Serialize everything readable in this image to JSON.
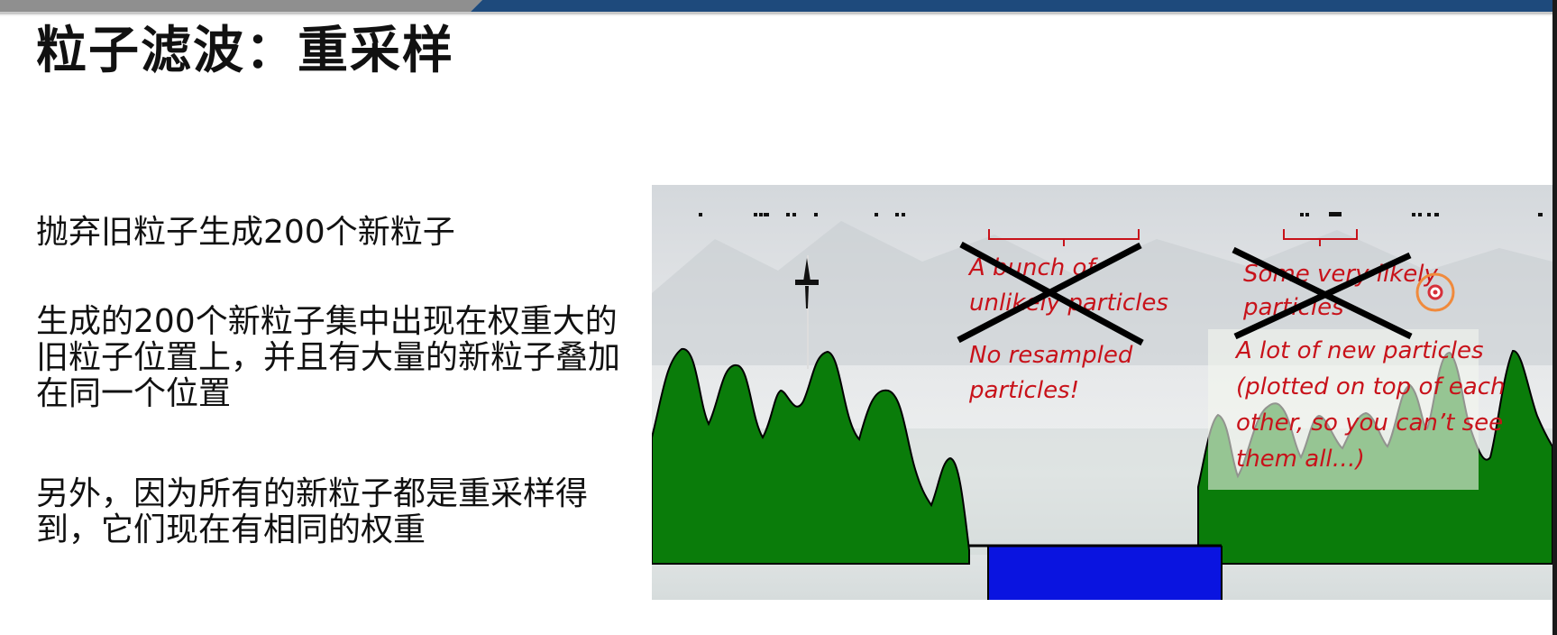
{
  "slide": {
    "title": "粒子滤波：重采样",
    "paragraphs": [
      "抛弃旧粒子生成200个新粒子",
      "生成的200个新粒子集中出现在权重大的旧粒子位置上，并且有大量的新粒子叠加在同一个位置",
      "另外，因为所有的新粒子都是重采样得到，它们现在有相同的权重"
    ]
  },
  "figure": {
    "annotation_left": {
      "crossed_line1": "A bunch of",
      "crossed_line2": "unlikely particles",
      "note_line1": "No resampled",
      "note_line2": "particles!"
    },
    "annotation_right": {
      "crossed_line1": "Some very likely",
      "crossed_line2": "particles",
      "note_line1": "A lot of new particles",
      "note_line2": "(plotted on top of each",
      "note_line3": "other, so you can’t see",
      "note_line4": "them all…)"
    },
    "colors": {
      "terrain": "#0a7c0a",
      "water": "#0a14e0",
      "annotation": "#c8121a",
      "cross": "#000000",
      "cursor_ring": "#f08a3c",
      "header_bar": "#1e4a7c"
    },
    "icons": [
      "airplane-icon",
      "cursor-highlight-icon"
    ]
  }
}
